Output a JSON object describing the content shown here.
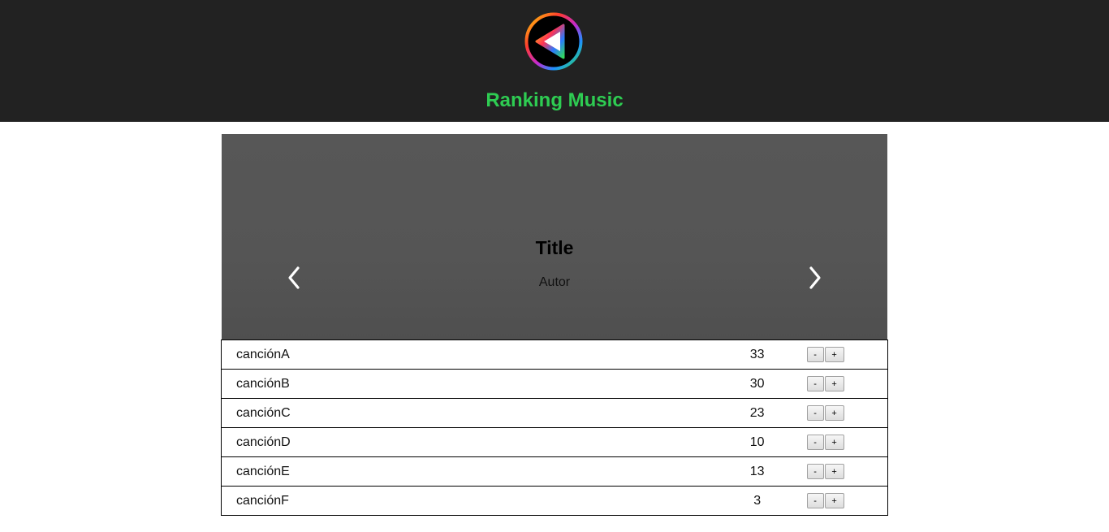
{
  "header": {
    "logo_icon": "play-triangle-rainbow-icon",
    "title": "Ranking Music",
    "title_color": "#2ecc52",
    "background": "#222222"
  },
  "carousel": {
    "title": "Title",
    "author": "Autor",
    "prev_icon": "chevron-left-icon",
    "next_icon": "chevron-right-icon"
  },
  "songs": [
    {
      "name": "canciónA",
      "votes": "33",
      "minus": "-",
      "plus": "+"
    },
    {
      "name": "canciónB",
      "votes": "30",
      "minus": "-",
      "plus": "+"
    },
    {
      "name": "canciónC",
      "votes": "23",
      "minus": "-",
      "plus": "+"
    },
    {
      "name": "canciónD",
      "votes": "10",
      "minus": "-",
      "plus": "+"
    },
    {
      "name": "canciónE",
      "votes": "13",
      "minus": "-",
      "plus": "+"
    },
    {
      "name": "canciónF",
      "votes": "3",
      "minus": "-",
      "plus": "+"
    }
  ]
}
